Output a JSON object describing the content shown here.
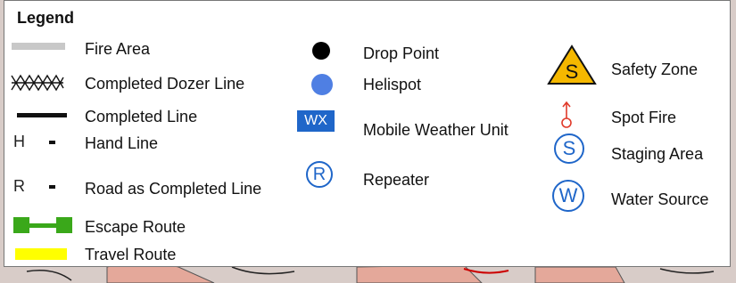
{
  "legend": {
    "title": "Legend",
    "items": {
      "fire_area": "Fire Area",
      "completed_dozer_line": "Completed Dozer Line",
      "completed_line": "Completed Line",
      "hand_line": "Hand Line",
      "road_as_completed_line": "Road as Completed Line",
      "escape_route": "Escape Route",
      "travel_route": "Travel Route",
      "drop_point": "Drop Point",
      "helispot": "Helispot",
      "mobile_weather_unit": "Mobile Weather Unit",
      "repeater": "Repeater",
      "safety_zone": "Safety Zone",
      "spot_fire": "Spot Fire",
      "staging_area": "Staging Area",
      "water_source": "Water Source"
    },
    "symbol_glyphs": {
      "hand_line": "H",
      "road_line": "R",
      "mobile_weather_unit": "WX",
      "repeater": "R",
      "safety_zone": "S",
      "staging_area": "S",
      "water_source": "W"
    }
  },
  "colors": {
    "fire_area": "#c8c8c8",
    "escape_route": "#3aa81a",
    "travel_route": "#ffff00",
    "helispot": "#4f7fe3",
    "weather_unit": "#1f66c9",
    "safety_zone": "#f5b800",
    "spot_fire": "#e03a2a",
    "blue_symbol": "#1f66c9"
  }
}
